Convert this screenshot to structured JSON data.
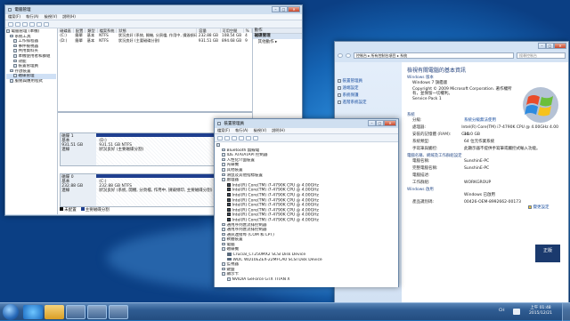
{
  "dm": {
    "title": "電腦管理",
    "menu": [
      "檔案(F)",
      "執行(A)",
      "檢視(V)",
      "說明(H)"
    ],
    "tree": [
      {
        "label": "電腦管理 (本機)",
        "indent": 0
      },
      {
        "label": "系統工具",
        "indent": 1
      },
      {
        "label": "工作排程器",
        "indent": 2
      },
      {
        "label": "事件檢視器",
        "indent": 2
      },
      {
        "label": "共用資料夾",
        "indent": 2
      },
      {
        "label": "本機使用者和群組",
        "indent": 2
      },
      {
        "label": "效能",
        "indent": 2
      },
      {
        "label": "裝置管理員",
        "indent": 2
      },
      {
        "label": "存放裝置",
        "indent": 1
      },
      {
        "label": "磁碟管理",
        "indent": 2
      },
      {
        "label": "服務與應用程式",
        "indent": 1
      }
    ],
    "vol_headers": [
      "磁碟區",
      "配置",
      "類型",
      "檔案系統",
      "狀態",
      "容量",
      "可用空間",
      "%"
    ],
    "volumes": [
      [
        "(C:)",
        "簡單",
        "基本",
        "NTFS",
        "狀況良好 (系統, 開機, 分頁檔, 作用中, 損毀傾印, 主要磁碟分割)",
        "232.88 GB",
        "108.54 GB",
        "4"
      ],
      [
        "(D:)",
        "簡單",
        "基本",
        "NTFS",
        "狀況良好 (主要磁碟分割)",
        "931.51 GB",
        "894.68 GB",
        "9"
      ]
    ],
    "actions_title": "動作",
    "actions_sub": "磁碟管理",
    "actions_more": "其他動作",
    "disks": [
      {
        "name": "磁碟 1",
        "type": "基本",
        "size": "931.51 GB",
        "status": "連線",
        "vol": "(D:)",
        "vsize": "931.51 GB NTFS",
        "vstat": "狀況良好 (主要磁碟分割)"
      },
      {
        "name": "磁碟 0",
        "type": "基本",
        "size": "232.88 GB",
        "status": "連線",
        "vol": "(C:)",
        "vsize": "232.88 GB NTFS",
        "vstat": "狀況良好 (系統, 開機, 分頁檔, 作用中, 損毀傾印, 主要磁碟分割)"
      }
    ],
    "legend": [
      "未配置",
      "主要磁碟分割"
    ]
  },
  "dev": {
    "title": "裝置管理員",
    "menu": [
      "檔案(F)",
      "執行(A)",
      "檢視(V)",
      "說明(H)"
    ],
    "items": [
      {
        "t": "Bluetooth 無線電",
        "i": 1,
        "k": "ic"
      },
      {
        "t": "IDE ATA/ATAPI 控制器",
        "i": 1,
        "k": "ic"
      },
      {
        "t": "人性化介面裝置",
        "i": 1,
        "k": "ic"
      },
      {
        "t": "光碟機",
        "i": 1,
        "k": "ic"
      },
      {
        "t": "其他裝置",
        "i": 1,
        "k": "ic"
      },
      {
        "t": "滑鼠及其他指標裝置",
        "i": 1,
        "k": "ic"
      },
      {
        "t": "處理器",
        "i": 1,
        "k": "ic"
      },
      {
        "t": "Intel(R) Core(TM) i7-4790K CPU @ 4.00GHz",
        "i": 2,
        "k": "cpu"
      },
      {
        "t": "Intel(R) Core(TM) i7-4790K CPU @ 4.00GHz",
        "i": 2,
        "k": "cpu"
      },
      {
        "t": "Intel(R) Core(TM) i7-4790K CPU @ 4.00GHz",
        "i": 2,
        "k": "cpu"
      },
      {
        "t": "Intel(R) Core(TM) i7-4790K CPU @ 4.00GHz",
        "i": 2,
        "k": "cpu"
      },
      {
        "t": "Intel(R) Core(TM) i7-4790K CPU @ 4.00GHz",
        "i": 2,
        "k": "cpu"
      },
      {
        "t": "Intel(R) Core(TM) i7-4790K CPU @ 4.00GHz",
        "i": 2,
        "k": "cpu"
      },
      {
        "t": "Intel(R) Core(TM) i7-4790K CPU @ 4.00GHz",
        "i": 2,
        "k": "cpu"
      },
      {
        "t": "Intel(R) Core(TM) i7-4790K CPU @ 4.00GHz",
        "i": 2,
        "k": "cpu"
      },
      {
        "t": "通用序列匯流排控制器",
        "i": 1,
        "k": "ic"
      },
      {
        "t": "通用序列匯流排控制器",
        "i": 1,
        "k": "ic"
      },
      {
        "t": "通訊連接埠 (COM 和 LPT)",
        "i": 1,
        "k": "ic"
      },
      {
        "t": "軟體裝置",
        "i": 1,
        "k": "ic"
      },
      {
        "t": "電腦",
        "i": 1,
        "k": "ic"
      },
      {
        "t": "磁碟機",
        "i": 1,
        "k": "ic"
      },
      {
        "t": "Crucial_CT250MX2 SCSI Disk Device",
        "i": 2,
        "k": "disk"
      },
      {
        "t": "WDC WD10EZEX-22MFCA0 SCSI Disk Device",
        "i": 2,
        "k": "disk"
      },
      {
        "t": "監視器",
        "i": 1,
        "k": "ic"
      },
      {
        "t": "鍵盤",
        "i": 1,
        "k": "ic"
      },
      {
        "t": "顯示卡",
        "i": 1,
        "k": "ic"
      },
      {
        "t": "NVIDIA GeForce GTX TITAN X",
        "i": 2,
        "k": "ic"
      }
    ]
  },
  "sys": {
    "address": "控制台 ▸ 所有控制台項目 ▸ 系統",
    "search": "搜尋控制台",
    "side": [
      "裝置管理員",
      "遠端設定",
      "系統保護",
      "進階系統設定"
    ],
    "heading": "檢視有關電腦的基本資訊",
    "edition_title": "Windows 版本",
    "edition": "Windows 7 旗艦版",
    "copyright": "Copyright © 2009 Microsoft Corporation. 著作權所有，並保留一切權利。",
    "sp": "Service Pack 1",
    "system_title": "系統",
    "system_rows": [
      [
        "分級:",
        "系統分級無法使用"
      ],
      [
        "處理器:",
        "Intel(R) Core(TM) i7-4790K CPU @ 4.00GHz   4.00 GHz"
      ],
      [
        "安裝的記憶體 (RAM):",
        "16.0 GB"
      ],
      [
        "系統類型:",
        "64 位元作業系統"
      ],
      [
        "手寫筆與觸控:",
        "此顯示器不提供手寫筆或觸控式輸入功能。"
      ]
    ],
    "comp_title": "電腦名稱、網域及工作群組設定",
    "comp_rows": [
      [
        "電腦名稱:",
        "SunshinE-PC"
      ],
      [
        "完整電腦名稱:",
        "SunshinE-PC"
      ],
      [
        "電腦描述:",
        ""
      ],
      [
        "工作群組:",
        "WORKGROUP"
      ]
    ],
    "change": "變更設定",
    "act_title": "Windows 啟用",
    "act_rows": [
      [
        "",
        "Windows 已啟用"
      ],
      [
        "產品識別碼:",
        "00426-OEM-8992662-00173"
      ]
    ],
    "genuine": "正版"
  },
  "clock": {
    "time": "上午 01:48",
    "date": "2015/12/21"
  },
  "lang": "CH"
}
